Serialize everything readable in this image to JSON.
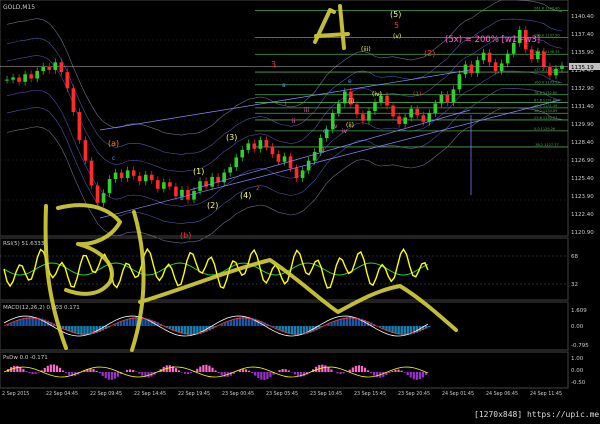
{
  "colors": {
    "background": "#000000",
    "up_candle": "#2fd12f",
    "down_candle": "#ff2a2a",
    "fib_line": "#4fa84f",
    "price_line": "#c0c0c0",
    "wave_label": "#ffff66",
    "wave_red": "#ff3333",
    "wave_orange": "#ff7a1a",
    "wave_blue": "#3aa0ff",
    "wave_pink": "#ff66cc",
    "marker_yellow": "#d7d23a",
    "rsi_line": "#ffff00",
    "grid": "#2a2a2a"
  },
  "header": {
    "symbol": "GOLD,M15"
  },
  "overlay": {
    "formula": "(5x) = 200% [w1+w3]",
    "wave_counts": {
      "top_five": "(5)",
      "red_five": "5",
      "red_two": "(2)",
      "red_one": "(1)",
      "orange_a": "(a)",
      "red_b": "(b)",
      "one": "(1)",
      "two": "(2)",
      "three": "(3)",
      "four": "(4)",
      "red_three": "3",
      "red_four": "4",
      "red_two_small": "2",
      "roman_i": "(i)",
      "roman_ii": "(ii)",
      "roman_iii": "(iii)",
      "roman_iv": "(iv)",
      "roman_v": "(v)",
      "roman_v_small": "v",
      "roman_iv_small": "iv",
      "roman_iii_small": "iii",
      "roman_ii_small": "ii",
      "roman_i_small": "i",
      "a": "a",
      "b": "b",
      "c": "c",
      "d": "d",
      "e": "e"
    },
    "marker_digits": {
      "big_three": "3",
      "big_four": "4"
    }
  },
  "price_axis": {
    "labels": [
      "1140.40",
      "1137.40",
      "1135.90",
      "1134.40",
      "1132.90",
      "1131.40",
      "1129.90",
      "1128.40",
      "1126.90",
      "1125.40",
      "1123.90",
      "1122.40",
      "1120.90"
    ],
    "current_price": "1135.19"
  },
  "fib_levels": [
    {
      "label": "261.8  1140.40",
      "value": 1140.4
    },
    {
      "label": "200.0  1137.90",
      "value": 1137.9
    },
    {
      "label": "161.8  1136.35",
      "value": 1136.35
    },
    {
      "label": "127.2  1134.70",
      "value": 1134.7
    },
    {
      "label": "100.0  1133.53",
      "value": 1133.53
    },
    {
      "label": "78.6  1132.60",
      "value": 1132.6
    },
    {
      "label": "61.8  1131.89",
      "value": 1131.89
    },
    {
      "label": "50.0  1131.39",
      "value": 1131.39
    },
    {
      "label": "38.2  1130.89",
      "value": 1130.89
    },
    {
      "label": "23.6  1130.27",
      "value": 1130.27
    },
    {
      "label": "0.0  1129.26",
      "value": 1129.26
    },
    {
      "label": "-38.2  1127.77",
      "value": 1127.77
    }
  ],
  "panels": {
    "rsi": {
      "label": "RSI(5) 51.6333",
      "levels": [
        "68",
        "32"
      ]
    },
    "macd": {
      "label": "MACD(12,26,2) 0.203 0.171",
      "levels": [
        "1.609",
        "0.00",
        "-0.795"
      ]
    },
    "pulse": {
      "label": "PsDw 0.0 -0.171",
      "levels": [
        "1.00",
        "0.00",
        "-0.50"
      ]
    }
  },
  "time_axis": {
    "labels": [
      "2 Sep 2015",
      "22 Sep 04:45",
      "22 Sep 09:45",
      "22 Sep 14:45",
      "22 Sep 19:45",
      "23 Sep 00:45",
      "23 Sep 05:45",
      "23 Sep 10:45",
      "23 Sep 15:45",
      "23 Sep 20:45",
      "24 Sep 01:45",
      "24 Sep 06:45",
      "24 Sep 11:45"
    ]
  },
  "watermark": "[1270x848] https://upic.me/",
  "chart_data": {
    "type": "candlestick",
    "symbol": "GOLD",
    "timeframe": "M15",
    "ylim": [
      1119.9,
      1141.0
    ],
    "close_series": [
      1134.0,
      1134.2,
      1133.8,
      1134.5,
      1134.1,
      1134.8,
      1135.2,
      1134.9,
      1135.6,
      1134.7,
      1133.2,
      1131.0,
      1128.4,
      1126.5,
      1124.2,
      1122.6,
      1123.5,
      1124.8,
      1125.4,
      1124.9,
      1125.6,
      1125.1,
      1124.6,
      1125.2,
      1124.7,
      1123.9,
      1124.5,
      1124.1,
      1123.2,
      1123.8,
      1122.9,
      1123.7,
      1124.6,
      1124.1,
      1125.0,
      1124.5,
      1125.4,
      1125.9,
      1126.8,
      1127.5,
      1128.1,
      1127.6,
      1128.4,
      1127.8,
      1127.1,
      1126.4,
      1126.9,
      1125.8,
      1124.9,
      1125.6,
      1126.5,
      1127.3,
      1128.6,
      1129.4,
      1130.9,
      1131.8,
      1132.9,
      1131.7,
      1130.8,
      1130.2,
      1131.1,
      1131.9,
      1132.5,
      1131.6,
      1130.6,
      1129.9,
      1130.5,
      1131.3,
      1130.7,
      1130.1,
      1130.9,
      1131.8,
      1132.6,
      1131.9,
      1133.1,
      1134.5,
      1135.4,
      1134.6,
      1135.8,
      1136.5,
      1135.6,
      1134.8,
      1135.5,
      1136.4,
      1137.4,
      1138.6,
      1136.8,
      1135.9,
      1136.6,
      1135.2,
      1134.4,
      1135.0,
      1135.3
    ]
  }
}
